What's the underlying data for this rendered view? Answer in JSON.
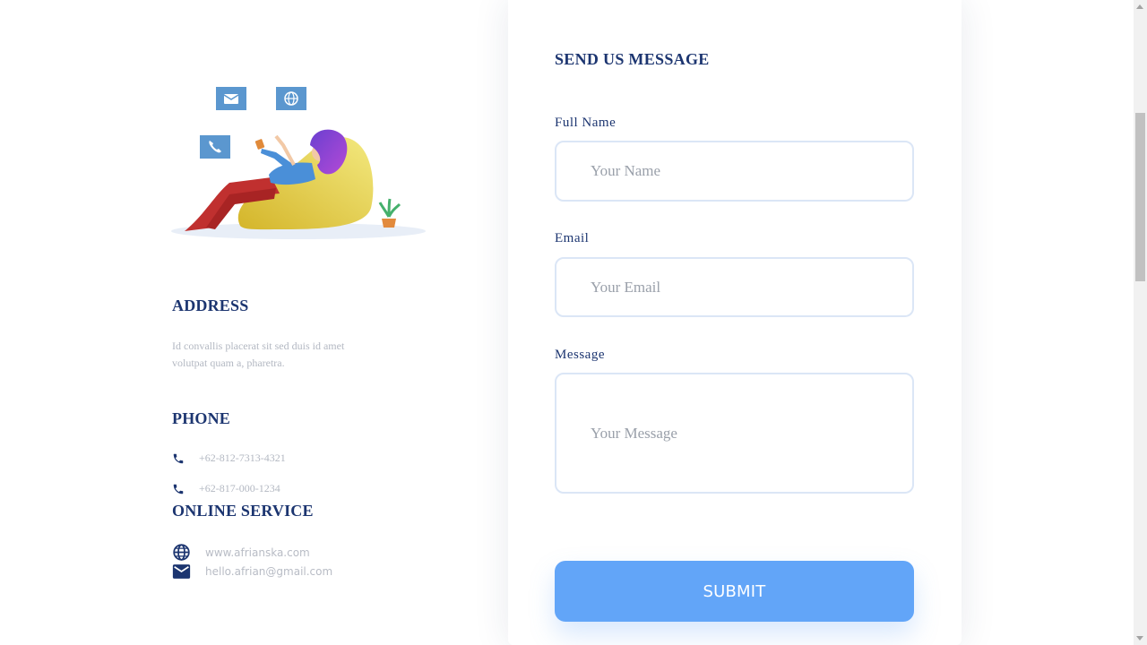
{
  "illustration": {
    "icons": [
      "mail-icon",
      "globe-icon",
      "phone-icon"
    ]
  },
  "address": {
    "title": "ADDRESS",
    "text": "Id convallis placerat sit sed duis id amet volutpat quam a, pharetra."
  },
  "phone": {
    "title": "PHONE",
    "numbers": [
      "+62-812-7313-4321",
      "+62-817-000-1234"
    ],
    "icon": "phone-icon"
  },
  "online_service": {
    "title": "ONLINE SERVICE",
    "website": "www.afrianska.com",
    "email": "hello.afrian@gmail.com",
    "icons": [
      "globe-icon",
      "mail-icon"
    ]
  },
  "form": {
    "title": "SEND US MESSAGE",
    "name_label": "Full Name",
    "name_placeholder": "Your Name",
    "email_label": "Email",
    "email_placeholder": "Your Email",
    "message_label": "Message",
    "message_placeholder": "Your Message",
    "submit_label": "SUBMIT"
  },
  "colors": {
    "heading": "#1c3570",
    "accent": "#62a5f8",
    "muted_text": "#b3b8c2",
    "field_border": "#dbe6f6"
  }
}
